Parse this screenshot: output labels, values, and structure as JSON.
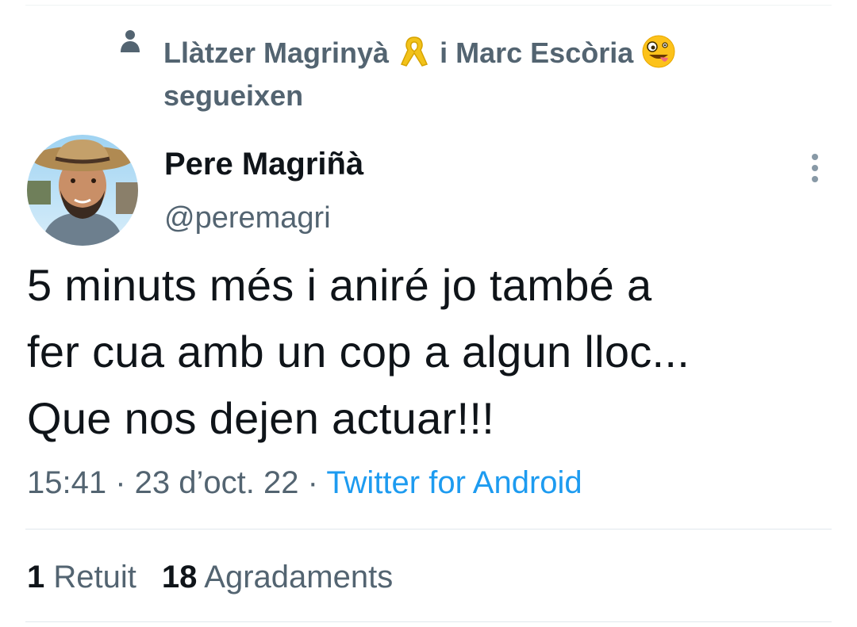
{
  "social_context": {
    "user1": "Llàtzer Magrinyà",
    "user1_badge_icon": "yellow-ribbon-icon",
    "connector": " i ",
    "user2": "Marc Escòria",
    "user2_badge_icon": "zany-face-emoji-icon",
    "action": "segueixen"
  },
  "author": {
    "name": "Pere Magriñà",
    "handle": "@peremagri",
    "avatar_icon": "user-photo"
  },
  "tweet": {
    "lines": [
      "5 minuts més i aniré jo també a",
      "fer cua amb un cop a algun lloc...",
      "Que nos dejen actuar!!!"
    ]
  },
  "meta": {
    "time": "15:41",
    "separator": " · ",
    "date": "23 d’oct. 22",
    "source": "Twitter for Android"
  },
  "stats": {
    "retweets_count": "1",
    "retweets_label": "Retuit",
    "likes_count": "18",
    "likes_label": "Agradaments"
  },
  "colors": {
    "primary_text": "#0f1419",
    "secondary_text": "#536471",
    "link": "#1d9bf0",
    "divider": "#e1e8ed"
  }
}
